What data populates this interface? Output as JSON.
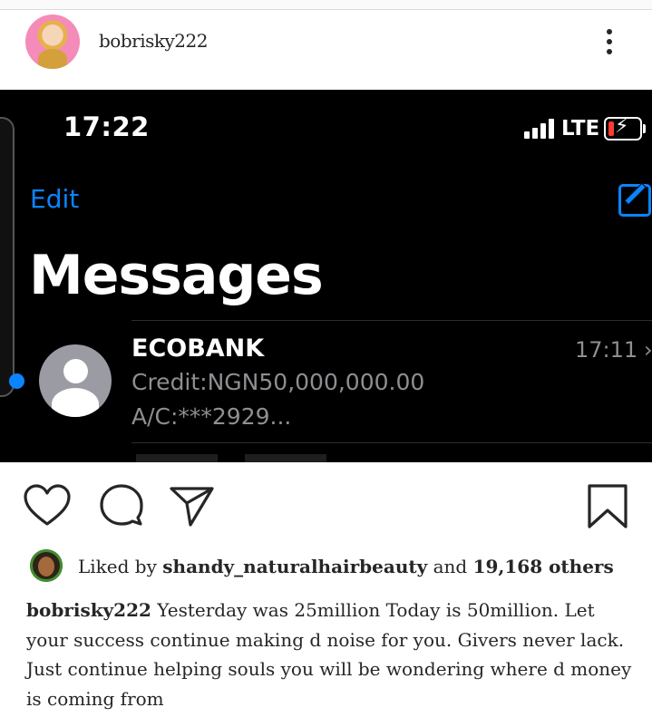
{
  "post": {
    "username": "bobrisky222",
    "more_icon": "more-vertical-icon"
  },
  "screenshot": {
    "time": "17:22",
    "network": "LTE",
    "nav_left": "Edit",
    "compose_icon": "compose-icon",
    "title": "Messages",
    "message": {
      "sender": "ECOBANK",
      "time": "17:11",
      "chevron": "›",
      "preview_line1": "Credit:NGN50,000,000.00",
      "preview_line2": "A/C:***2929..."
    },
    "colors": {
      "accent": "#0a84ff",
      "battery_low": "#ff3b30",
      "background": "#000000"
    },
    "battery_bolt": "⚡"
  },
  "actions": {
    "like_icon": "heart-icon",
    "comment_icon": "comment-icon",
    "share_icon": "send-icon",
    "save_icon": "bookmark-icon"
  },
  "likes": {
    "prefix": "Liked by ",
    "user": "shandy_naturalhairbeauty",
    "middle": " and ",
    "others": "19,168 others"
  },
  "caption": {
    "username": "bobrisky222",
    "text": " Yesterday was 25million Today is 50million. Let your success continue making d noise for you. Givers never lack. Just continue helping souls you will be wondering where d money is coming from"
  }
}
